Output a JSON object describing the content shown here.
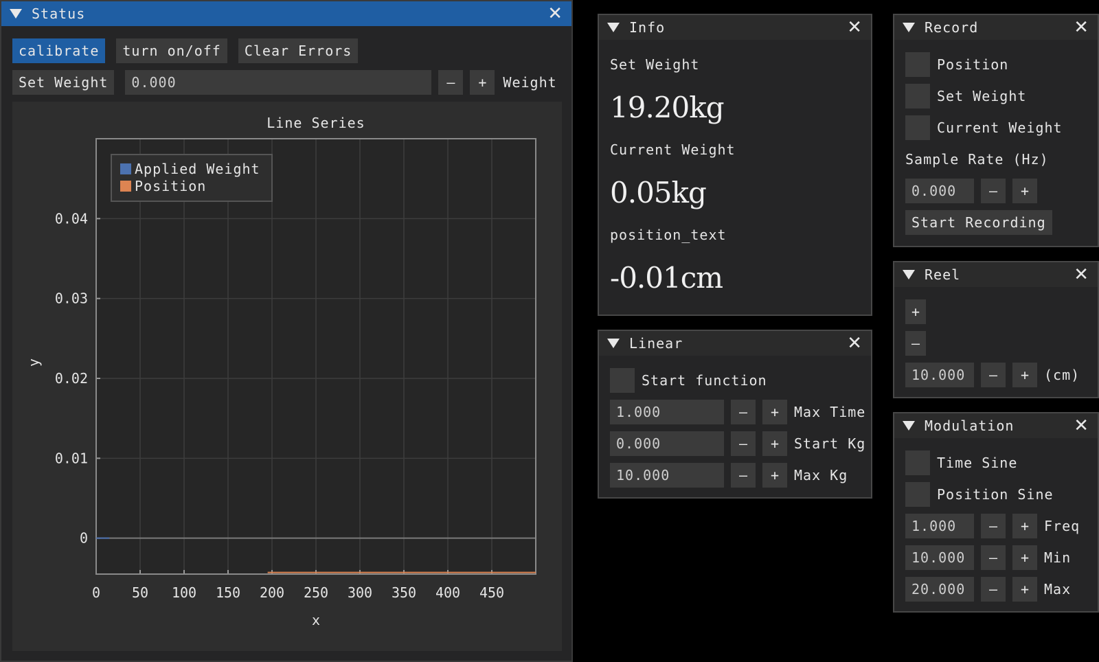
{
  "status": {
    "title": "Status",
    "calibrate": "calibrate",
    "turn_onoff": "turn on/off",
    "clear_errors": "Clear Errors",
    "set_weight_label": "Set Weight",
    "weight_value": "0.000",
    "minus": "–",
    "plus": "+",
    "weight_suffix": "Weight",
    "chart": {
      "title": "Line Series",
      "xlabel": "x",
      "ylabel": "y",
      "legend": [
        "Applied Weight",
        "Position"
      ],
      "xticks": [
        "0",
        "50",
        "100",
        "150",
        "200",
        "250",
        "300",
        "350",
        "400",
        "450"
      ],
      "yticks": [
        "0.04",
        "0.03",
        "0.02",
        "0.01",
        "0"
      ]
    }
  },
  "chart_data": {
    "type": "line",
    "title": "Line Series",
    "xlabel": "x",
    "ylabel": "y",
    "xlim": [
      0,
      500
    ],
    "ylim": [
      -0.0045,
      0.05
    ],
    "grid": true,
    "legend_position": "top-left",
    "series": [
      {
        "name": "Applied Weight",
        "color": "#4c72b0",
        "x": [
          0,
          15
        ],
        "y": [
          0,
          0
        ]
      },
      {
        "name": "Position",
        "color": "#dd8452",
        "x": [
          195,
          500
        ],
        "y": [
          -0.0043,
          -0.0043
        ]
      }
    ]
  },
  "info": {
    "title": "Info",
    "set_weight_label": "Set Weight",
    "set_weight_value": "19.20kg",
    "current_weight_label": "Current Weight",
    "current_weight_value": "0.05kg",
    "position_label": "position_text",
    "position_value": "-0.01cm"
  },
  "linear": {
    "title": "Linear",
    "start_function": "Start function",
    "rows": [
      {
        "value": "1.000",
        "label": "Max Time"
      },
      {
        "value": "0.000",
        "label": "Start Kg"
      },
      {
        "value": "10.000",
        "label": "Max Kg"
      }
    ]
  },
  "record": {
    "title": "Record",
    "checks": [
      "Position",
      "Set Weight",
      "Current Weight"
    ],
    "sample_rate_label": "Sample Rate (Hz)",
    "sample_rate_value": "0.000",
    "start_recording": "Start Recording"
  },
  "reel": {
    "title": "Reel",
    "plus": "+",
    "minus": "–",
    "value": "10.000",
    "unit": "(cm)"
  },
  "modulation": {
    "title": "Modulation",
    "checks": [
      "Time Sine",
      "Position Sine"
    ],
    "rows": [
      {
        "value": "1.000",
        "label": "Freq"
      },
      {
        "value": "10.000",
        "label": "Min"
      },
      {
        "value": "20.000",
        "label": "Max"
      }
    ]
  },
  "common": {
    "close": "✕",
    "minus": "–",
    "plus": "+"
  },
  "colors": {
    "active_title": "#1f5ea3",
    "applied_weight": "#4c72b0",
    "position": "#dd8452"
  }
}
